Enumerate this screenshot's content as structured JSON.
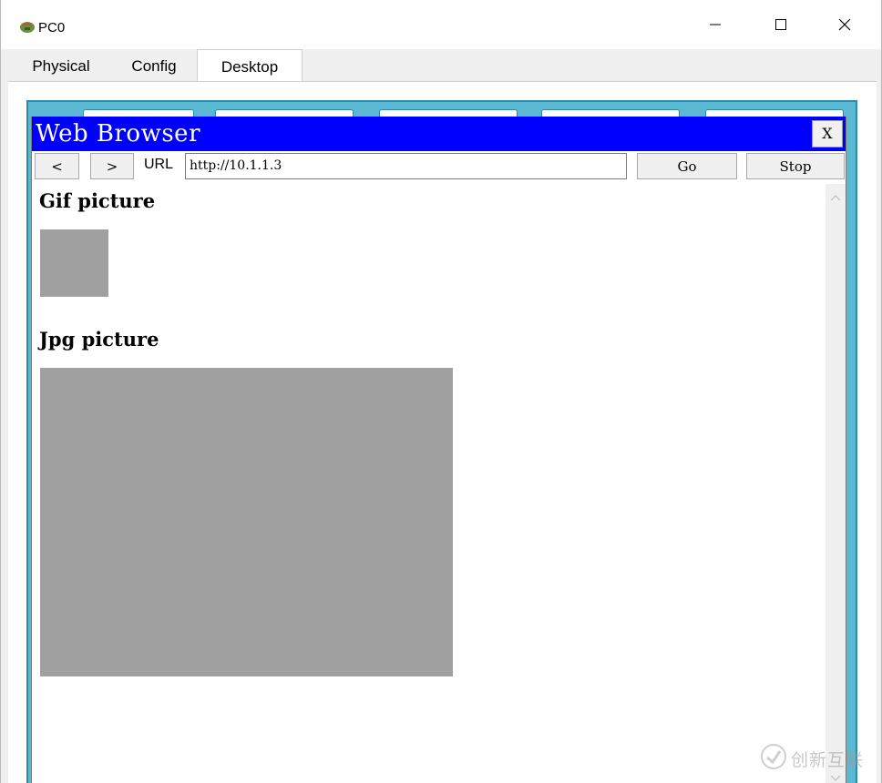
{
  "window": {
    "title": "PC0",
    "app_icon": "packet-tracer-pc-icon",
    "controls": {
      "minimize": "minimize-icon",
      "maximize": "maximize-icon",
      "close": "close-icon"
    }
  },
  "tabs": [
    {
      "label": "Physical",
      "selected": false
    },
    {
      "label": "Config",
      "selected": false
    },
    {
      "label": "Desktop",
      "selected": true
    }
  ],
  "browser": {
    "title": "Web Browser",
    "close_label": "X",
    "back_icon": "chevron-left-icon",
    "back_label": "<",
    "forward_icon": "chevron-right-icon",
    "forward_label": ">",
    "url_label": "URL",
    "url_value": "http://10.1.1.3",
    "go_label": "Go",
    "stop_label": "Stop"
  },
  "page": {
    "gif_heading": "Gif picture",
    "jpg_heading": "Jpg picture"
  },
  "watermark": {
    "text": "创新互联",
    "icon": "watermark-logo-icon"
  },
  "colors": {
    "browser_titlebar": "#0000ff",
    "desktop_frame": "#5bb8d3",
    "image_placeholder": "#a0a0a0"
  }
}
